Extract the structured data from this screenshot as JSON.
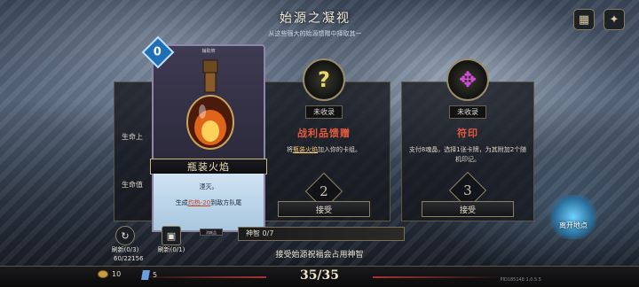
{
  "header": {
    "title": "始源之凝视",
    "subtitle": "从这些强大的始源馈赠中择取其一"
  },
  "top_buttons": [
    {
      "icon": "map-icon"
    },
    {
      "icon": "compass-icon"
    }
  ],
  "hidden_panel": {
    "text_a": "生命上",
    "text_b": "生命值"
  },
  "card": {
    "cost": "0",
    "type": "辅助牌",
    "name": "瓶装火焰",
    "keyword": "湮灭。",
    "effect_prefix": "生成",
    "effect_link": "灼热-20",
    "effect_suffix": "到敌方队尾",
    "footer": "消耗品"
  },
  "rewards": [
    {
      "status": "未收录",
      "title": "战利品馈赠",
      "desc_prefix": "将",
      "desc_link": "瓶装火焰",
      "desc_suffix": "加入你的卡组。",
      "cost": "2",
      "accept": "接受"
    },
    {
      "status": "未收录",
      "title": "符印",
      "desc": "支付8魂晶，选择1张卡牌，为其附加2个随机印记。",
      "cost": "3",
      "accept": "接受"
    }
  ],
  "divine": {
    "label": "神智",
    "value": "0/7"
  },
  "status_text": "接受始源祝福会占用神智",
  "portal_label": "离开地点",
  "left_widgets": [
    {
      "icon": "refresh-icon",
      "label": "刷新(0/3)"
    },
    {
      "icon": "refresh-card-icon",
      "label": "刷新(0/1)"
    }
  ],
  "deck_count": "60/22156",
  "bottom": {
    "gold": "10",
    "gems": "5",
    "progress": "35/35",
    "version": "PID185148  1.0.5.5"
  },
  "colors": {
    "accent_red": "#e55a3c",
    "card_cost_blue": "#1e6fb5",
    "gold_border": "#c8b37a"
  }
}
